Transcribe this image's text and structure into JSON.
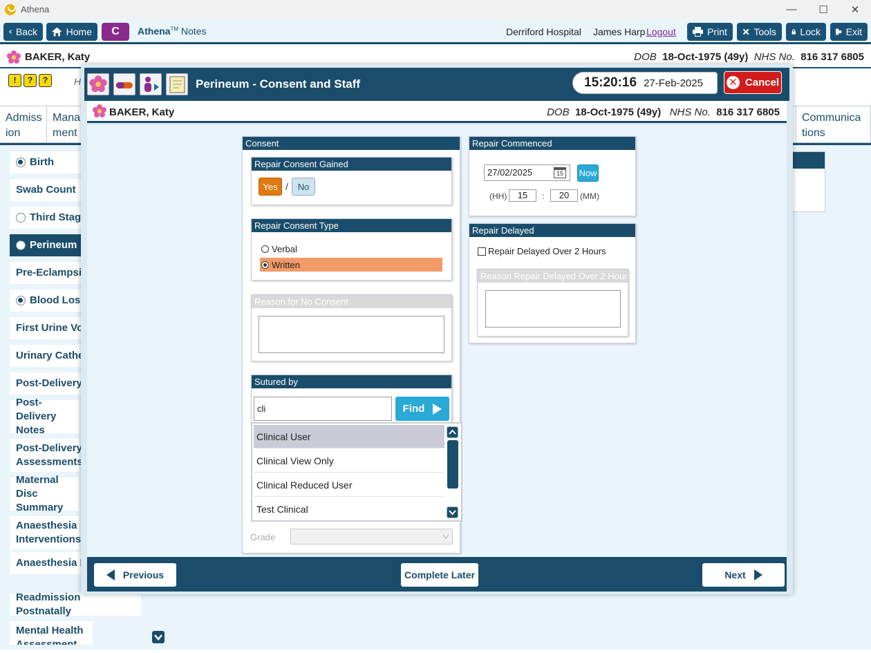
{
  "window": {
    "title": "Athena",
    "minimize": "—",
    "maximize": "☐",
    "close": "✕"
  },
  "toolbar": {
    "back": "Back",
    "home": "Home",
    "c": "C",
    "athena": "Athena",
    "tm": "TM",
    "notes": "Notes",
    "hospital": "Derriford Hospital",
    "user": "James Harp",
    "logout": "Logout",
    "print": "Print",
    "tools": "Tools",
    "lock": "Lock",
    "exit": "Exit"
  },
  "patient": {
    "name": "BAKER, Katy",
    "dob_label": "DOB",
    "dob": "18-Oct-1975 (49y)",
    "nhs_label": "NHS No.",
    "nhs": "816 317 6805"
  },
  "background": {
    "h_letter": "H",
    "tabs": [
      {
        "line1": "Admiss",
        "line2": "ion"
      },
      {
        "line1": "Mana",
        "line2": "ment"
      },
      {
        "line1": "Communica",
        "line2": "tions"
      }
    ],
    "sidebar": [
      {
        "label": "Birth",
        "radio": "on"
      },
      {
        "label": "Swab Count",
        "radio": "none"
      },
      {
        "label": "Third Stage",
        "radio": "off"
      },
      {
        "label": "Perineum",
        "radio": "off",
        "active": true
      },
      {
        "label": "Pre-Eclampsia",
        "radio": "none"
      },
      {
        "label": "Blood Loss",
        "radio": "on"
      },
      {
        "label": "First Urine Voi",
        "radio": "none"
      },
      {
        "label": "Urinary Cathe",
        "radio": "none"
      },
      {
        "label": "Post-Delivery",
        "radio": "none"
      },
      {
        "label": "Post-Delivery Notes",
        "radio": "none"
      },
      {
        "label": "Post-Delivery Assessments",
        "radio": "none"
      },
      {
        "label": "Maternal Disc Summary",
        "radio": "none"
      },
      {
        "label": "Anaesthesia Interventions",
        "radio": "none"
      },
      {
        "label": "Anaesthesia F",
        "radio": "none"
      },
      {
        "label": "Readmission Postnatally",
        "radio": "none"
      },
      {
        "label": "Mental Health Assessment",
        "radio": "none"
      }
    ]
  },
  "modal": {
    "title": "Perineum - Consent and Staff",
    "time": "15:20:16",
    "date": "27-Feb-2025",
    "cancel": "Cancel",
    "consent": {
      "header": "Consent",
      "gained_header": "Repair Consent Gained",
      "yes": "Yes",
      "slash": "/",
      "no": "No",
      "type_header": "Repair Consent Type",
      "verbal": "Verbal",
      "written": "Written",
      "reason_header": "Reason for No Consent",
      "sutured_header": "Sutured by",
      "sutured_value": "cli",
      "find": "Find",
      "results": [
        "Clinical User",
        "Clinical View Only",
        "Clinical Reduced User",
        "Test Clinical"
      ],
      "grade_label": "Grade"
    },
    "repair": {
      "header": "Repair Commenced",
      "date": "27/02/2025",
      "calendar_day": "15",
      "now": "Now",
      "hh_label": "(HH)",
      "hh": "15",
      "colon": ":",
      "mm": "20",
      "mm_label": "(MM)",
      "delayed_header": "Repair Delayed",
      "delayed_check": "Repair Delayed Over 2 Hours",
      "delayed_reason_header": "Reason Repair Delayed Over 2 Hour"
    },
    "footer": {
      "previous": "Previous",
      "complete_later": "Complete Later",
      "next": "Next"
    }
  }
}
